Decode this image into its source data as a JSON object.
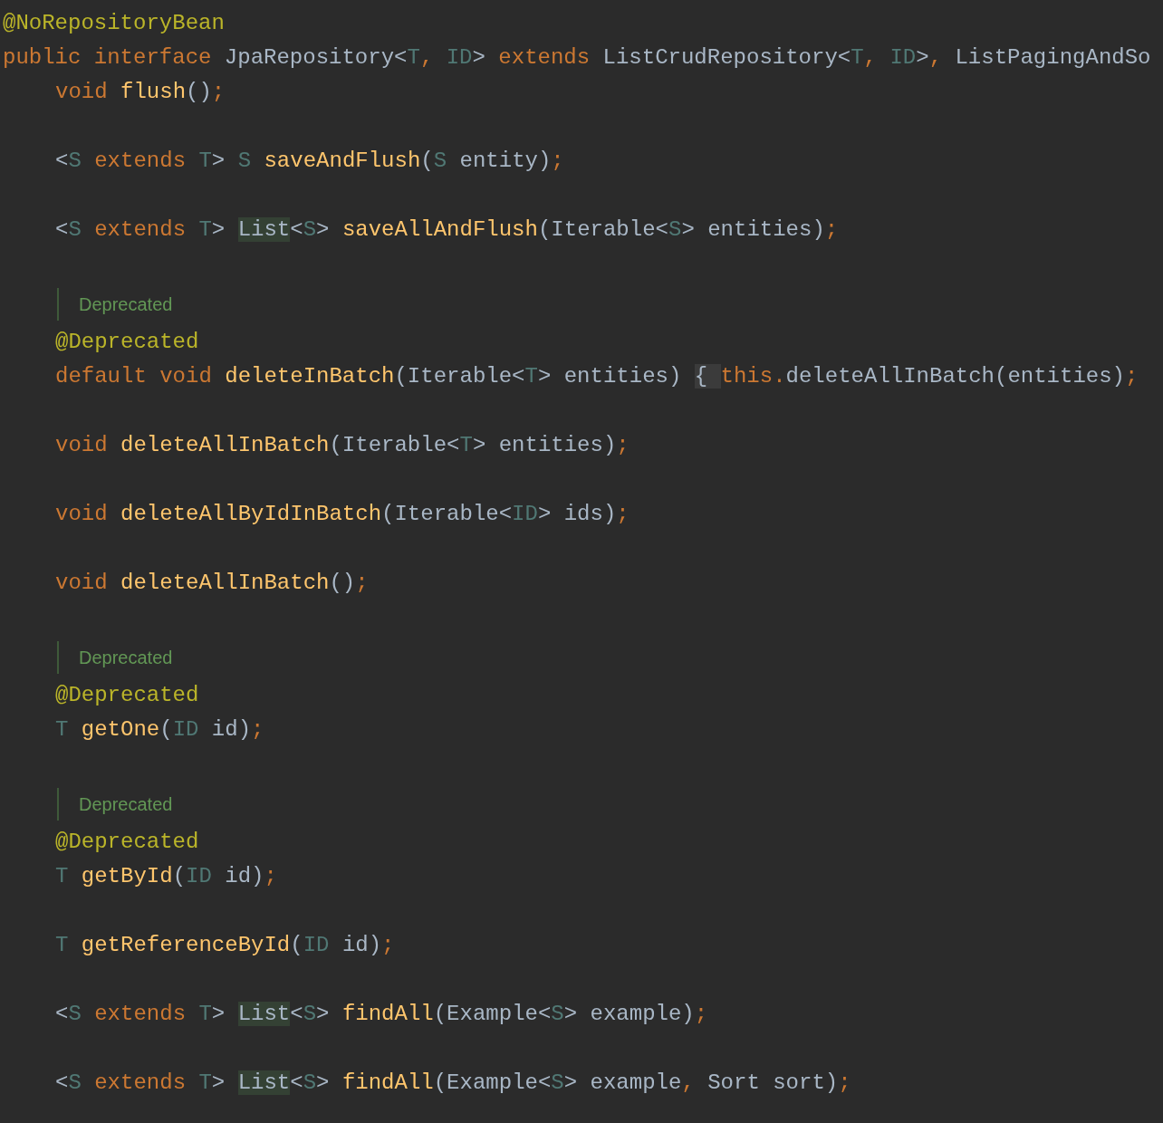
{
  "lines": [
    {
      "kind": "code",
      "tokens": [
        {
          "t": "@NoRepositoryBean",
          "kind": "ann"
        }
      ]
    },
    {
      "kind": "code",
      "tokens": [
        {
          "t": "public interface ",
          "kind": "kw"
        },
        {
          "t": "JpaRepository<",
          "kind": "id"
        },
        {
          "t": "T",
          "kind": "tp"
        },
        {
          "t": ", ",
          "kind": "kw"
        },
        {
          "t": "ID",
          "kind": "tp"
        },
        {
          "t": "> ",
          "kind": "id"
        },
        {
          "t": "extends ",
          "kind": "kw"
        },
        {
          "t": "ListCrudRepository<",
          "kind": "id"
        },
        {
          "t": "T",
          "kind": "tp"
        },
        {
          "t": ", ",
          "kind": "kw"
        },
        {
          "t": "ID",
          "kind": "tp"
        },
        {
          "t": ">",
          "kind": "id"
        },
        {
          "t": ", ",
          "kind": "kw"
        },
        {
          "t": "ListPagingAndSo",
          "kind": "id"
        }
      ],
      "children": [
        {
          "kind": "code",
          "tokens": [
            {
              "t": "void ",
              "kind": "kw"
            },
            {
              "t": "flush",
              "kind": "fn"
            },
            {
              "t": "()",
              "kind": "id"
            },
            {
              "t": ";",
              "kind": "kw"
            }
          ]
        },
        {
          "kind": "blank"
        },
        {
          "kind": "code",
          "tokens": [
            {
              "t": "<",
              "kind": "id"
            },
            {
              "t": "S ",
              "kind": "tp"
            },
            {
              "t": "extends ",
              "kind": "kw"
            },
            {
              "t": "T",
              "kind": "tp"
            },
            {
              "t": "> ",
              "kind": "id"
            },
            {
              "t": "S ",
              "kind": "tp"
            },
            {
              "t": "saveAndFlush",
              "kind": "fn"
            },
            {
              "t": "(",
              "kind": "id"
            },
            {
              "t": "S ",
              "kind": "tp"
            },
            {
              "t": "entity)",
              "kind": "id"
            },
            {
              "t": ";",
              "kind": "kw"
            }
          ]
        },
        {
          "kind": "blank"
        },
        {
          "kind": "code",
          "tokens": [
            {
              "t": "<",
              "kind": "id"
            },
            {
              "t": "S ",
              "kind": "tp"
            },
            {
              "t": "extends ",
              "kind": "kw"
            },
            {
              "t": "T",
              "kind": "tp"
            },
            {
              "t": "> ",
              "kind": "id"
            },
            {
              "t": "List",
              "kind": "hl"
            },
            {
              "t": "<",
              "kind": "id"
            },
            {
              "t": "S",
              "kind": "tp"
            },
            {
              "t": "> ",
              "kind": "id"
            },
            {
              "t": "saveAllAndFlush",
              "kind": "fn"
            },
            {
              "t": "(Iterable<",
              "kind": "id"
            },
            {
              "t": "S",
              "kind": "tp"
            },
            {
              "t": "> entities)",
              "kind": "id"
            },
            {
              "t": ";",
              "kind": "kw"
            }
          ]
        },
        {
          "kind": "blank"
        },
        {
          "kind": "doc",
          "text": "Deprecated"
        },
        {
          "kind": "code",
          "tokens": [
            {
              "t": "@Deprecated",
              "kind": "ann"
            }
          ]
        },
        {
          "kind": "code",
          "tokens": [
            {
              "t": "default void ",
              "kind": "kw"
            },
            {
              "t": "deleteInBatch",
              "kind": "fn"
            },
            {
              "t": "(Iterable<",
              "kind": "id"
            },
            {
              "t": "T",
              "kind": "tp"
            },
            {
              "t": "> entities) ",
              "kind": "id"
            },
            {
              "t": "{ ",
              "kind": "fold"
            },
            {
              "t": "this",
              "kind": "kw"
            },
            {
              "t": ".",
              "kind": "kw"
            },
            {
              "t": "deleteAllInBatch(entities)",
              "kind": "id"
            },
            {
              "t": ";",
              "kind": "kw"
            }
          ]
        },
        {
          "kind": "blank"
        },
        {
          "kind": "code",
          "tokens": [
            {
              "t": "void ",
              "kind": "kw"
            },
            {
              "t": "deleteAllInBatch",
              "kind": "fn"
            },
            {
              "t": "(Iterable<",
              "kind": "id"
            },
            {
              "t": "T",
              "kind": "tp"
            },
            {
              "t": "> entities)",
              "kind": "id"
            },
            {
              "t": ";",
              "kind": "kw"
            }
          ]
        },
        {
          "kind": "blank"
        },
        {
          "kind": "code",
          "tokens": [
            {
              "t": "void ",
              "kind": "kw"
            },
            {
              "t": "deleteAllByIdInBatch",
              "kind": "fn"
            },
            {
              "t": "(Iterable<",
              "kind": "id"
            },
            {
              "t": "ID",
              "kind": "tp"
            },
            {
              "t": "> ids)",
              "kind": "id"
            },
            {
              "t": ";",
              "kind": "kw"
            }
          ]
        },
        {
          "kind": "blank"
        },
        {
          "kind": "code",
          "tokens": [
            {
              "t": "void ",
              "kind": "kw"
            },
            {
              "t": "deleteAllInBatch",
              "kind": "fn"
            },
            {
              "t": "()",
              "kind": "id"
            },
            {
              "t": ";",
              "kind": "kw"
            }
          ]
        },
        {
          "kind": "blank"
        },
        {
          "kind": "doc",
          "text": "Deprecated"
        },
        {
          "kind": "code",
          "tokens": [
            {
              "t": "@Deprecated",
              "kind": "ann"
            }
          ]
        },
        {
          "kind": "code",
          "tokens": [
            {
              "t": "T ",
              "kind": "tp"
            },
            {
              "t": "getOne",
              "kind": "fn"
            },
            {
              "t": "(",
              "kind": "id"
            },
            {
              "t": "ID ",
              "kind": "tp"
            },
            {
              "t": "id)",
              "kind": "id"
            },
            {
              "t": ";",
              "kind": "kw"
            }
          ]
        },
        {
          "kind": "blank"
        },
        {
          "kind": "doc",
          "text": "Deprecated"
        },
        {
          "kind": "code",
          "tokens": [
            {
              "t": "@Deprecated",
              "kind": "ann"
            }
          ]
        },
        {
          "kind": "code",
          "tokens": [
            {
              "t": "T ",
              "kind": "tp"
            },
            {
              "t": "getById",
              "kind": "fn"
            },
            {
              "t": "(",
              "kind": "id"
            },
            {
              "t": "ID ",
              "kind": "tp"
            },
            {
              "t": "id)",
              "kind": "id"
            },
            {
              "t": ";",
              "kind": "kw"
            }
          ]
        },
        {
          "kind": "blank"
        },
        {
          "kind": "code",
          "tokens": [
            {
              "t": "T ",
              "kind": "tp"
            },
            {
              "t": "getReferenceById",
              "kind": "fn"
            },
            {
              "t": "(",
              "kind": "id"
            },
            {
              "t": "ID ",
              "kind": "tp"
            },
            {
              "t": "id)",
              "kind": "id"
            },
            {
              "t": ";",
              "kind": "kw"
            }
          ]
        },
        {
          "kind": "blank"
        },
        {
          "kind": "code",
          "tokens": [
            {
              "t": "<",
              "kind": "id"
            },
            {
              "t": "S ",
              "kind": "tp"
            },
            {
              "t": "extends ",
              "kind": "kw"
            },
            {
              "t": "T",
              "kind": "tp"
            },
            {
              "t": "> ",
              "kind": "id"
            },
            {
              "t": "List",
              "kind": "hl"
            },
            {
              "t": "<",
              "kind": "id"
            },
            {
              "t": "S",
              "kind": "tp"
            },
            {
              "t": "> ",
              "kind": "id"
            },
            {
              "t": "findAll",
              "kind": "fn"
            },
            {
              "t": "(Example<",
              "kind": "id"
            },
            {
              "t": "S",
              "kind": "tp"
            },
            {
              "t": "> example)",
              "kind": "id"
            },
            {
              "t": ";",
              "kind": "kw"
            }
          ]
        },
        {
          "kind": "blank"
        },
        {
          "kind": "code",
          "tokens": [
            {
              "t": "<",
              "kind": "id"
            },
            {
              "t": "S ",
              "kind": "tp"
            },
            {
              "t": "extends ",
              "kind": "kw"
            },
            {
              "t": "T",
              "kind": "tp"
            },
            {
              "t": "> ",
              "kind": "id"
            },
            {
              "t": "List",
              "kind": "hl"
            },
            {
              "t": "<",
              "kind": "id"
            },
            {
              "t": "S",
              "kind": "tp"
            },
            {
              "t": "> ",
              "kind": "id"
            },
            {
              "t": "findAll",
              "kind": "fn"
            },
            {
              "t": "(Example<",
              "kind": "id"
            },
            {
              "t": "S",
              "kind": "tp"
            },
            {
              "t": "> example",
              "kind": "id"
            },
            {
              "t": ", ",
              "kind": "kw"
            },
            {
              "t": "Sort sort)",
              "kind": "id"
            },
            {
              "t": ";",
              "kind": "kw"
            }
          ]
        }
      ]
    }
  ]
}
